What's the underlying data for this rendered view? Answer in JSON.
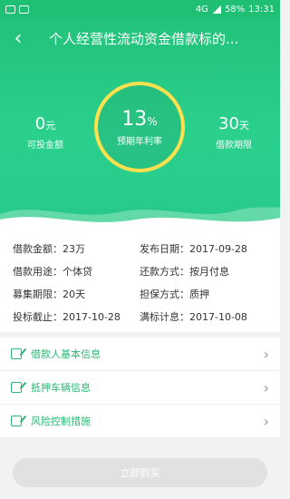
{
  "status_bar": {
    "battery": "58%",
    "time": "13:31",
    "network": "4G"
  },
  "header": {
    "back_icon": "chevron-left-icon",
    "title": "个人经营性流动资金借款标的..."
  },
  "stats": {
    "invest": {
      "value": "0",
      "unit": "元",
      "label": "可投金额"
    },
    "rate": {
      "value": "13",
      "unit": "%",
      "label": "预期年利率"
    },
    "term": {
      "value": "30",
      "unit": "天",
      "label": "借款期限"
    }
  },
  "details": [
    {
      "label": "借款金额：",
      "value": "23万"
    },
    {
      "label": "发布日期：",
      "value": "2017-09-28"
    },
    {
      "label": "借款用途：",
      "value": "个体贷"
    },
    {
      "label": "还款方式：",
      "value": "按月付息"
    },
    {
      "label": "募集期限：",
      "value": "20天"
    },
    {
      "label": "担保方式：",
      "value": "质押"
    },
    {
      "label": "投标截止：",
      "value": "2017-10-28"
    },
    {
      "label": "满标计息：",
      "value": "2017-10-08"
    }
  ],
  "menu": [
    {
      "label": "借款人基本信息",
      "icon": "edit-icon"
    },
    {
      "label": "抵押车辆信息",
      "icon": "edit-icon"
    },
    {
      "label": "风险控制措施",
      "icon": "edit-icon"
    }
  ],
  "buy_button": {
    "label": "立即购买",
    "enabled": false
  },
  "colors": {
    "primary": "#22c27a",
    "ring": "#ffe14d",
    "link": "#2bb673",
    "disabled": "#e1e1e1"
  }
}
